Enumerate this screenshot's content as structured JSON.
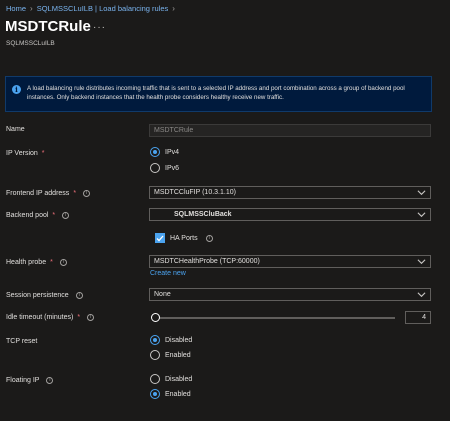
{
  "breadcrumb": {
    "items": [
      "Home",
      "SQLMSSCLuILB | Load balancing rules"
    ]
  },
  "header": {
    "title": "MSDTCRule",
    "more": "···",
    "subtitle": "SQLMSSCLuILB"
  },
  "info": {
    "text": "A load balancing rule distributes incoming traffic that is sent to a selected IP address and port combination across a group of backend pool instances. Only backend instances that the health probe considers healthy receive new traffic."
  },
  "form": {
    "name": {
      "label": "Name",
      "value": "MSDTCRule"
    },
    "ip_version": {
      "label": "IP Version",
      "required": "*",
      "options": [
        "IPv4",
        "IPv6"
      ],
      "selected": "IPv4"
    },
    "frontend_ip": {
      "label": "Frontend IP address",
      "required": "*",
      "value": "MSDTCCluFIP (10.3.1.10)"
    },
    "backend_pool": {
      "label": "Backend pool",
      "required": "*",
      "value": "SQLMSSCluBack"
    },
    "ha_ports": {
      "label": "HA Ports",
      "checked": true
    },
    "health_probe": {
      "label": "Health probe",
      "required": "*",
      "value": "MSDTCHealthProbe (TCP:60000)",
      "create_new": "Create new"
    },
    "session_persistence": {
      "label": "Session persistence",
      "value": "None"
    },
    "idle_timeout": {
      "label": "Idle timeout (minutes)",
      "required": "*",
      "value": "4"
    },
    "tcp_reset": {
      "label": "TCP reset",
      "options": [
        "Disabled",
        "Enabled"
      ],
      "selected": "Disabled"
    },
    "floating_ip": {
      "label": "Floating IP",
      "options": [
        "Disabled",
        "Enabled"
      ],
      "selected": "Enabled"
    }
  },
  "colors": {
    "background": "#1b1a19",
    "accent": "#4ba3ef",
    "link": "#7ab4ef",
    "info_background": "#001a3d",
    "required": "#f1707b"
  }
}
